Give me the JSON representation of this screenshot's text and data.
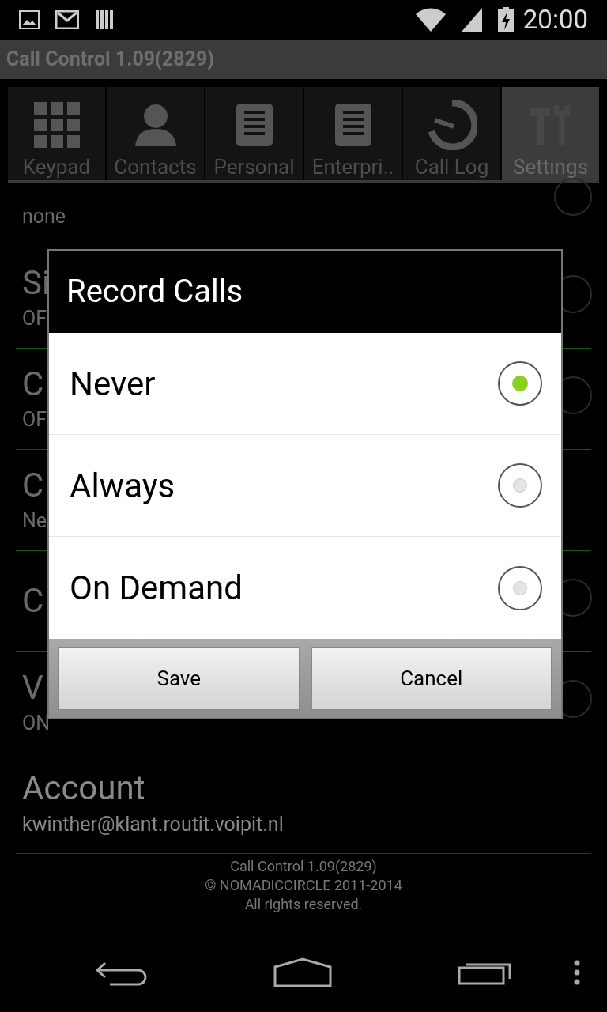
{
  "status_bar": {
    "time": "20:00"
  },
  "app_bar": {
    "title": "Call Control 1.09(2829)"
  },
  "tabs": [
    {
      "label": "Keypad",
      "kind": "grid",
      "selected": false
    },
    {
      "label": "Contacts",
      "kind": "person",
      "selected": false
    },
    {
      "label": "Personal",
      "kind": "document",
      "selected": false
    },
    {
      "label": "Enterpri..",
      "kind": "document",
      "selected": false
    },
    {
      "label": "Call Log",
      "kind": "dial",
      "selected": false
    },
    {
      "label": "Settings",
      "kind": "tools",
      "selected": true
    }
  ],
  "settings": [
    {
      "value": "none",
      "help_icon": true
    },
    {
      "title": "Si",
      "value": "OF",
      "help_icon": true
    },
    {
      "title": "C",
      "value": "OF",
      "help_icon": true
    },
    {
      "title": "C",
      "value": "Ne",
      "help_icon": false
    },
    {
      "title": "C",
      "help_icon": true
    },
    {
      "title": "V",
      "value": "ON",
      "help_icon": true
    },
    {
      "title": "Account",
      "value": "kwinther@klant.routit.voipit.nl",
      "help_icon": false
    }
  ],
  "footer": [
    "Call Control 1.09(2829)",
    "© NOMADICCIRCLE 2011-2014",
    "All rights reserved."
  ],
  "dialog": {
    "title": "Record Calls",
    "options": [
      {
        "label": "Never",
        "selected": true
      },
      {
        "label": "Always",
        "selected": false
      },
      {
        "label": "On Demand",
        "selected": false
      }
    ],
    "buttons": [
      "Save",
      "Cancel"
    ]
  }
}
